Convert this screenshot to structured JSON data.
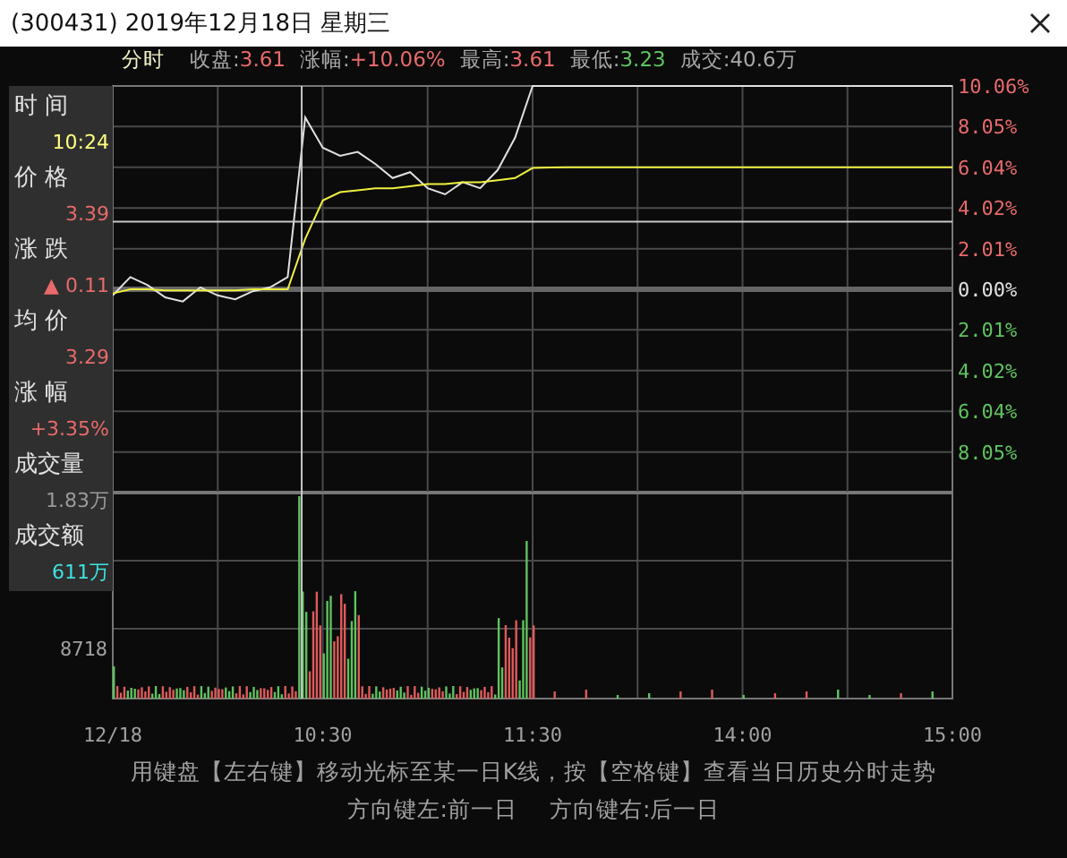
{
  "window": {
    "title": "(300431) 2019年12月18日 星期三"
  },
  "info_bar": {
    "mode": "分时",
    "stats": [
      {
        "label": "收盘:",
        "value": "3.61",
        "color": "#e86a6a"
      },
      {
        "label": "涨幅:",
        "value": "+10.06%",
        "color": "#e86a6a"
      },
      {
        "label": "最高:",
        "value": "3.61",
        "color": "#e86a6a"
      },
      {
        "label": "最低:",
        "value": "3.23",
        "color": "#5fc35f"
      },
      {
        "label": "成交:",
        "value": "40.6万",
        "color": "#a8a8a8"
      }
    ]
  },
  "cursor_panel": {
    "items": [
      {
        "label": "时 间",
        "value": "10:24",
        "color": "#ffff80"
      },
      {
        "label": "价 格",
        "value": "3.39",
        "color": "#e86a6a"
      },
      {
        "label": "涨 跌",
        "value": "▲ 0.11",
        "color": "#e86a6a"
      },
      {
        "label": "均 价",
        "value": "3.29",
        "color": "#e86a6a"
      },
      {
        "label": "涨 幅",
        "value": "+3.35%",
        "color": "#e86a6a"
      },
      {
        "label": "成交量",
        "value": "1.83万",
        "color": "#9a9a9a"
      },
      {
        "label": "成交额",
        "value": "611万",
        "color": "#40e0e0"
      }
    ]
  },
  "price_chart": {
    "chart_data": {
      "type": "line",
      "series": [
        {
          "color": "#e0e0e0",
          "values": [
            -0.3,
            0.6,
            0.2,
            -0.4,
            -0.6,
            0.1,
            -0.3,
            -0.5,
            -0.1,
            0.1,
            0.6,
            8.5,
            7.0,
            6.6,
            6.8,
            6.2,
            5.5,
            5.8,
            5.0,
            4.7,
            5.3,
            5.0,
            5.9,
            7.5,
            10.06,
            10.06,
            10.06,
            10.06,
            10.06,
            10.06,
            10.06,
            10.06,
            10.06,
            10.06,
            10.06,
            10.06,
            10.06,
            10.06,
            10.06,
            10.06,
            10.06,
            10.06,
            10.06,
            10.06,
            10.06,
            10.06,
            10.06,
            10.06,
            10.06
          ]
        },
        {
          "color": "#f0f040",
          "values": [
            -0.2,
            0,
            0,
            -0.05,
            -0.05,
            -0.05,
            -0.05,
            -0.05,
            0,
            0,
            0,
            2.5,
            4.4,
            4.8,
            4.9,
            5.0,
            5.0,
            5.1,
            5.2,
            5.2,
            5.3,
            5.3,
            5.4,
            5.5,
            6.0,
            6.03,
            6.04,
            6.04,
            6.04,
            6.04,
            6.04,
            6.04,
            6.04,
            6.04,
            6.04,
            6.04,
            6.04,
            6.04,
            6.04,
            6.04,
            6.04,
            6.04,
            6.04,
            6.04,
            6.04,
            6.04,
            6.04,
            6.04,
            6.04
          ]
        }
      ],
      "ylim": [
        -10.06,
        10.06
      ],
      "yticks": [
        {
          "value": 10.06,
          "label": "10.06%"
        },
        {
          "value": 8.05,
          "label": "8.05%"
        },
        {
          "value": 6.04,
          "label": "6.04%"
        },
        {
          "value": 4.02,
          "label": "4.02%"
        },
        {
          "value": 2.01,
          "label": "2.01%"
        },
        {
          "value": 0,
          "label": "0.00%"
        },
        {
          "value": -2.01,
          "label": "2.01%"
        },
        {
          "value": -4.02,
          "label": "4.02%"
        },
        {
          "value": -6.04,
          "label": "6.04%"
        },
        {
          "value": -8.05,
          "label": "8.05%"
        }
      ],
      "grid": true,
      "ref_lines": [
        {
          "axis": "y",
          "value": 3.35
        }
      ]
    }
  },
  "volume_chart": {
    "tick_label": "8718",
    "time_labels": [
      "12/18",
      "10:30",
      "11:30",
      "14:00",
      "15:00"
    ]
  },
  "hint": {
    "line": "用键盘【左右键】移动光标至某一日K线，按【空格键】查看当日历史分时走势",
    "keys": [
      "方向键左:前一日",
      "方向键右:后一日"
    ]
  }
}
